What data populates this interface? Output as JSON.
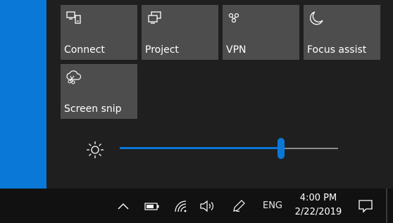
{
  "quick_actions": [
    {
      "label": "Connect",
      "icon": "connect-icon"
    },
    {
      "label": "Project",
      "icon": "project-icon"
    },
    {
      "label": "VPN",
      "icon": "vpn-icon"
    },
    {
      "label": "Focus assist",
      "icon": "moon-icon"
    },
    {
      "label": "Screen snip",
      "icon": "screen-snip-icon"
    }
  ],
  "brightness": {
    "icon": "sun-icon",
    "level": 0.74
  },
  "taskbar": {
    "language": "ENG",
    "time": "4:00 PM",
    "date": "2/22/2019",
    "icons": [
      "chevron-up-icon",
      "battery-icon",
      "wifi-icon",
      "volume-icon",
      "pen-icon",
      "notification-icon"
    ]
  },
  "colors": {
    "accent": "#0a78d7",
    "tile": "#4d4d4d",
    "panel": "#1f1f1f",
    "taskbar": "#111111"
  }
}
